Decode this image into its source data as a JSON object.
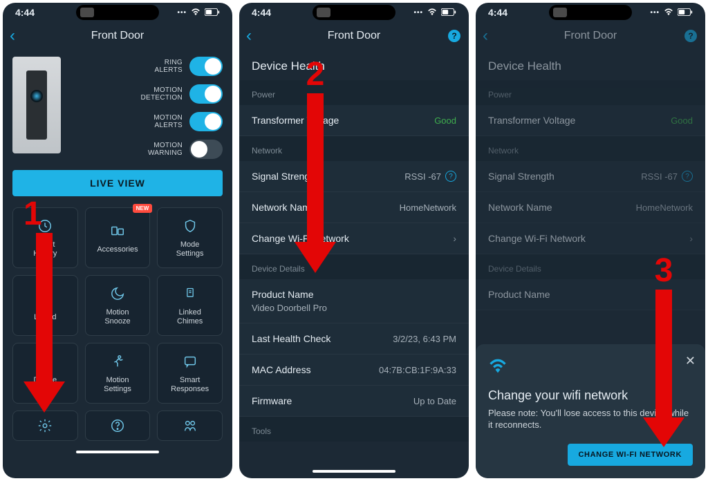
{
  "status": {
    "time": "4:44"
  },
  "screen1": {
    "title": "Front Door",
    "toggles": {
      "ring_alerts": "RING\nALERTS",
      "motion_detection": "MOTION\nDETECTION",
      "motion_alerts": "MOTION\nALERTS",
      "motion_warning": "MOTION\nWARNING"
    },
    "live_view": "LIVE VIEW",
    "tiles": {
      "event_history": "Event\nHistory",
      "accessories": "Accessories",
      "mode_settings": "Mode\nSettings",
      "linked": "Linked",
      "motion_snooze": "Motion\nSnooze",
      "linked_chimes": "Linked\nChimes",
      "device_health": "Device\nHealth",
      "motion_settings": "Motion\nSettings",
      "smart_responses": "Smart\nResponses",
      "new_badge": "NEW"
    }
  },
  "screen2": {
    "title": "Front Door",
    "page_title": "Device Health",
    "groups": {
      "power": "Power",
      "network": "Network",
      "device_details": "Device Details",
      "tools": "Tools"
    },
    "rows": {
      "transformer_voltage_label": "Transformer Voltage",
      "transformer_voltage_value": "Good",
      "signal_strength_label": "Signal Strength",
      "signal_strength_value": "RSSI -67",
      "network_name_label": "Network Name",
      "network_name_value": "HomeNetwork",
      "change_wifi_label": "Change Wi-Fi Network",
      "product_name_label": "Product Name",
      "product_name_value": "Video Doorbell Pro",
      "last_health_label": "Last Health Check",
      "last_health_value": "3/2/23, 6:43 PM",
      "mac_label": "MAC Address",
      "mac_value": "04:7B:CB:1F:9A:33",
      "firmware_label": "Firmware",
      "firmware_value": "Up to Date"
    }
  },
  "screen3": {
    "title": "Front Door",
    "page_title": "Device Health",
    "modal": {
      "title": "Change your wifi network",
      "body": "Please note: You'll lose access to this device while it reconnects.",
      "button": "CHANGE WI-FI NETWORK"
    }
  },
  "annotations": {
    "one": "1",
    "two": "2",
    "three": "3"
  }
}
